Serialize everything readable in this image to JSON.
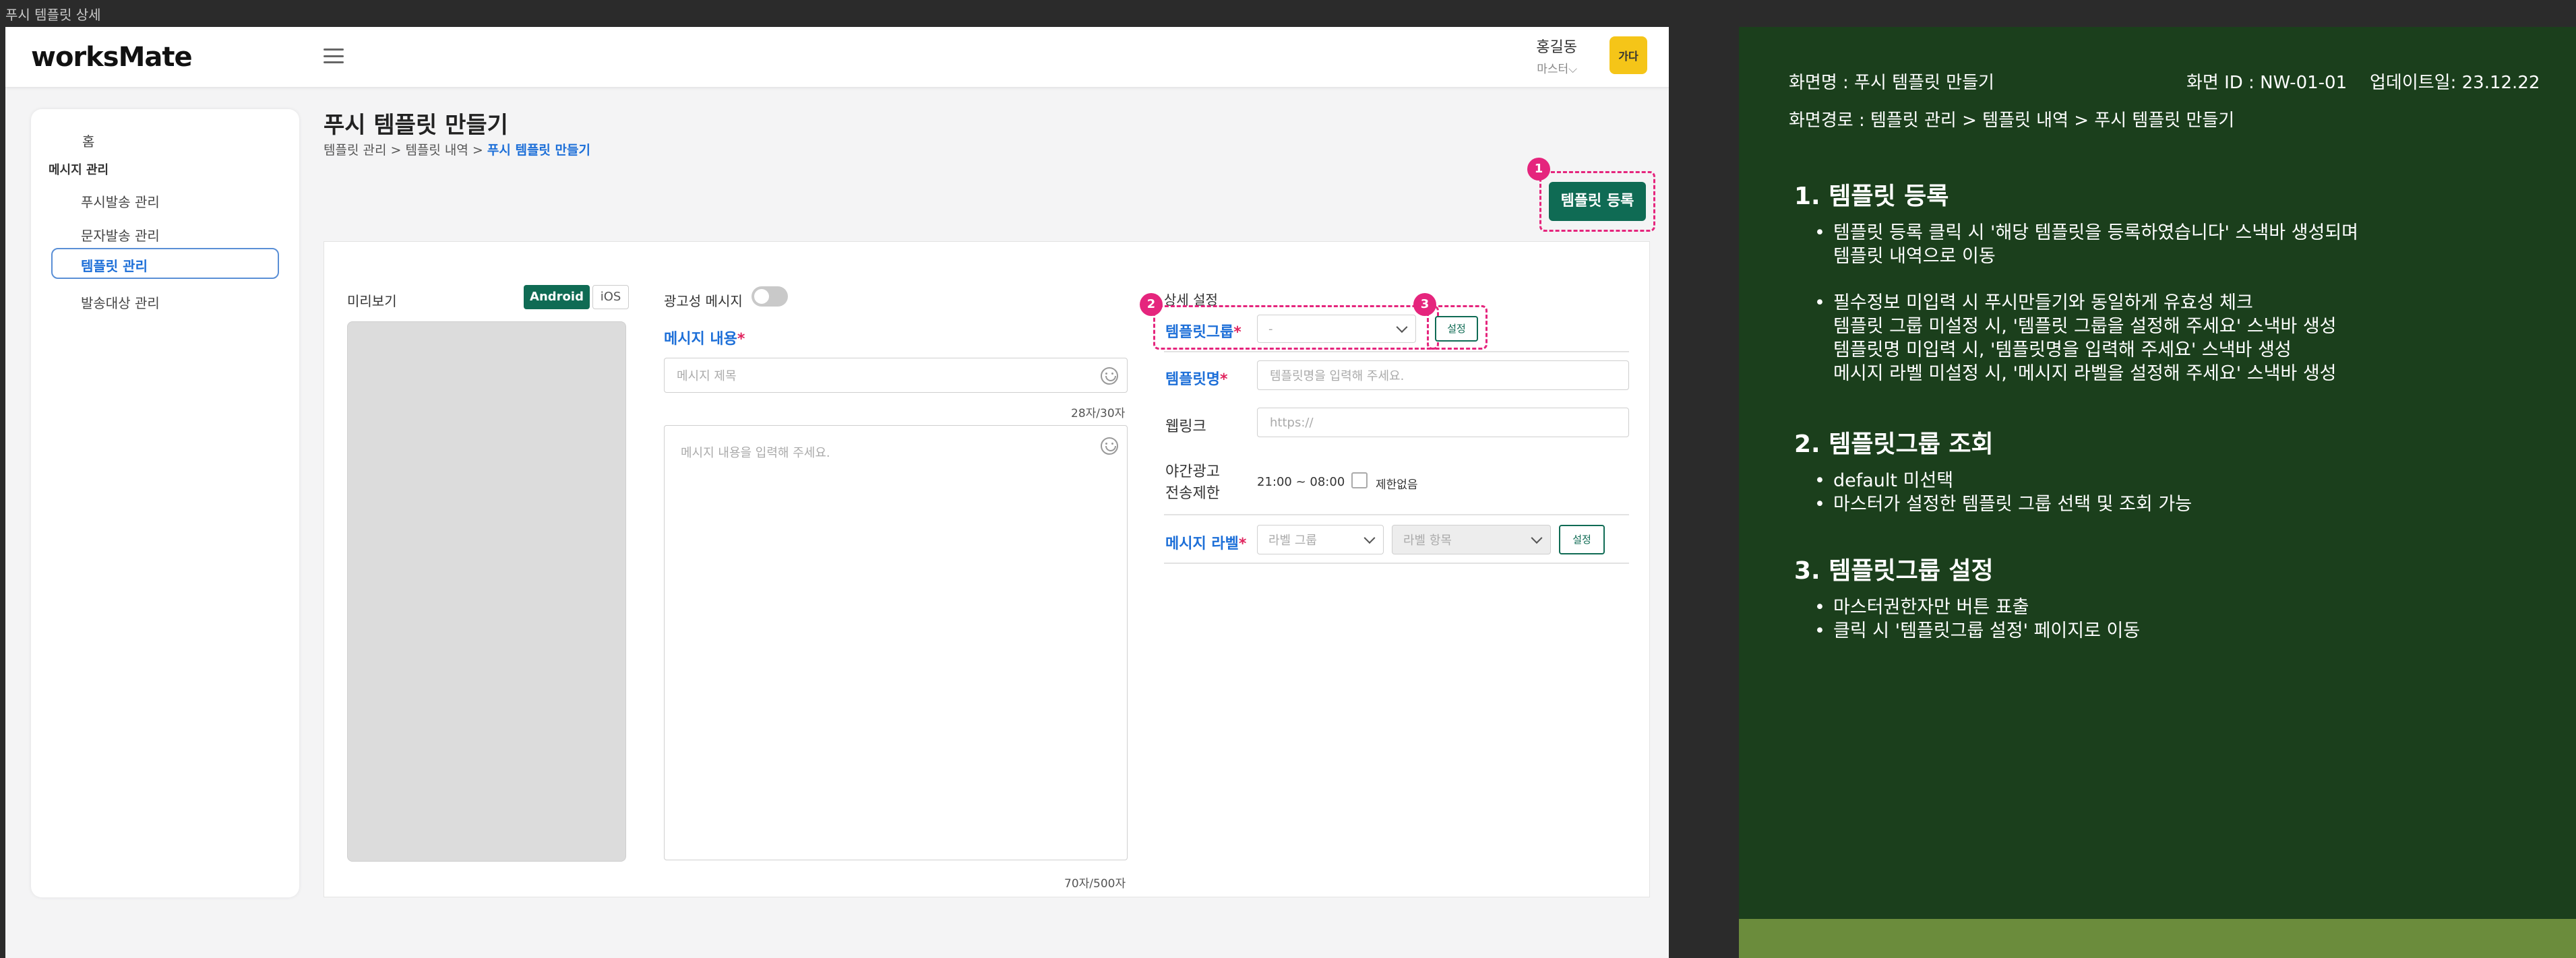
{
  "window_title": "푸시 템플릿 상세",
  "header": {
    "logo": "worksMate",
    "user_name": "홍길동",
    "user_role": "마스터⌵",
    "avatar_text": "가다"
  },
  "sidebar": {
    "home": "홈",
    "group": "메시지 관리",
    "items": [
      {
        "label": "푸시발송 관리"
      },
      {
        "label": "문자발송 관리"
      },
      {
        "label": "템플릿 관리"
      },
      {
        "label": "발송대상 관리"
      }
    ]
  },
  "page": {
    "title": "푸시 템플릿 만들기",
    "breadcrumb_prefix": "템플릿 관리 > 템플릿 내역 > ",
    "breadcrumb_current": "푸시 템플릿 만들기",
    "register_button": "템플릿 등록"
  },
  "badges": [
    "1",
    "2",
    "3"
  ],
  "preview": {
    "label": "미리보기",
    "android": "Android",
    "ios": "iOS"
  },
  "message": {
    "ad_label": "광고성 메시지",
    "content_label": "메시지 내용",
    "required_mark": "*",
    "title_placeholder": "메시지 제목",
    "title_counter": "28자/30자",
    "body_placeholder": "메시지 내용을 입력해 주세요.",
    "body_counter": "70자/500자"
  },
  "detail": {
    "section_label": "상세 설정",
    "template_group_label": "템플릿그룹",
    "template_group_value": "-",
    "set_button": "설정",
    "template_name_label": "템플릿명",
    "template_name_placeholder": "템플릿명을 입력해 주세요.",
    "weblink_label": "웹링크",
    "weblink_placeholder": "https://",
    "night_label_1": "야간광고",
    "night_label_2": "전송제한",
    "night_time": "21:00 ~ 08:00",
    "no_limit": "제한없음",
    "msg_label_label": "메시지 라벨",
    "label_group_placeholder": "라벨 그룹",
    "label_item_placeholder": "라벨 항목",
    "label_set_button": "설정"
  },
  "spec": {
    "screen_name": "화면명 : 푸시 템플릿 만들기",
    "screen_id": "화면 ID :  NW-01-01",
    "updated": "업데이트일: 23.12.22",
    "path": "화면경로 : 템플릿 관리 > 템플릿 내역 > 푸시 템플릿 만들기",
    "s1_title": "1. 템플릿 등록",
    "s1_b1_l1": "템플릿 등록 클릭 시 '해당 템플릿을 등록하였습니다' 스낵바 생성되며",
    "s1_b1_l2": "템플릿 내역으로 이동",
    "s1_b2_l1": "필수정보 미입력 시 푸시만들기와 동일하게 유효성 체크",
    "s1_b2_l2": "템플릿 그룹 미설정 시, '템플릿 그룹을 설정해 주세요' 스낵바 생성",
    "s1_b2_l3": "템플릿명 미입력 시, '템플릿명을 입력해 주세요' 스낵바 생성",
    "s1_b2_l4": "메시지 라벨 미설정 시, '메시지 라벨을 설정해 주세요' 스낵바 생성",
    "s2_title": "2. 템플릿그룹 조회",
    "s2_b1": "default 미선택",
    "s2_b2": "마스터가 설정한 템플릿 그룹 선택 및 조회 가능",
    "s3_title": "3. 템플릿그룹 설정",
    "s3_b1": "마스터권한자만 버튼 표출",
    "s3_b2": "클릭 시 '템플릿그룹 설정' 페이지로 이동"
  },
  "colors": {
    "primary": "#0f6b54",
    "accent_blue": "#1d6fd8",
    "annotation": "#e5257d",
    "spec_bg": "#1b3f1c"
  }
}
